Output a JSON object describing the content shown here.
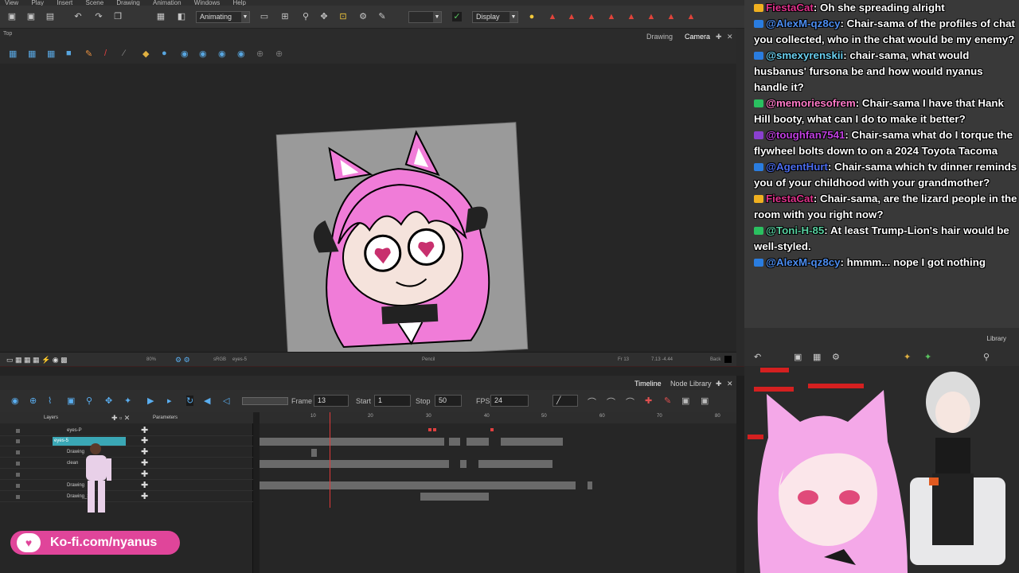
{
  "menu": [
    "View",
    "Play",
    "Insert",
    "Scene",
    "Drawing",
    "Animation",
    "Windows",
    "Help"
  ],
  "toolbar": {
    "mode_select": "Animating",
    "display_select": "Display"
  },
  "camera_view": {
    "title": "Top",
    "tabs": [
      "Drawing",
      "Camera"
    ]
  },
  "status_bar": {
    "zoom": "80%",
    "color_space": "sRGB",
    "layer": "eyes-5",
    "tool": "Pencil",
    "frame": "Fr 13",
    "coords": "7.13 -4.44",
    "bg": "Back"
  },
  "timeline": {
    "tabs": [
      "Timeline",
      "Node Library"
    ],
    "frame_label": "Frame",
    "frame_value": "13",
    "start_label": "Start",
    "start_value": "1",
    "stop_label": "Stop",
    "stop_value": "50",
    "fps_label": "FPS",
    "fps_value": "24",
    "layers_header": "Layers",
    "params_header": "Parameters",
    "ruler_ticks": [
      "10",
      "20",
      "30",
      "40",
      "50",
      "60",
      "70",
      "80"
    ],
    "layers": [
      {
        "name": "eyes-P",
        "selected": false
      },
      {
        "name": "eyes-5",
        "selected": true
      },
      {
        "name": "Drawing",
        "selected": false
      },
      {
        "name": "clean",
        "selected": false
      },
      {
        "name": "",
        "selected": false
      },
      {
        "name": "Drawing",
        "selected": false
      },
      {
        "name": "Drawing_3",
        "selected": false
      }
    ]
  },
  "kofi": {
    "text": "Ko-fi.com/nyanus"
  },
  "chat": [
    {
      "user": "FiestaCat",
      "user_color": "#e0338c",
      "message": "Oh she spreading alright"
    },
    {
      "user": "@AlexM-qz8cy",
      "user_color": "#4c8df0",
      "message": "Chair-sama of the profiles of chat you collected, who in the chat would be my enemy?"
    },
    {
      "user": "@smexyrenskii",
      "user_color": "#6ad0f0",
      "message": "chair-sama, what would husbanus' fursona be and how would nyanus handle it?"
    },
    {
      "user": "@memoriesofrem",
      "user_color": "#ff7ac8",
      "message": "Chair-sama I have that Hank Hill booty, what can I do to make it better?"
    },
    {
      "user": "@toughfan7541",
      "user_color": "#c040e0",
      "message": "Chair-sama what do I torque the flywheel bolts down to on a 2024 Toyota Tacoma"
    },
    {
      "user": "@AgentHurt",
      "user_color": "#4c6df0",
      "message": "Chair-sama which tv dinner reminds you of your childhood with your grandmother?"
    },
    {
      "user": "FiestaCat",
      "user_color": "#e0338c",
      "message": "Chair-sama, are the lizard people in the room with you right now?"
    },
    {
      "user": "@Toni-H-85",
      "user_color": "#58d0a0",
      "message": "At least Trump-Lion's hair would be well-styled."
    },
    {
      "user": "@AlexM-qz8cy",
      "user_color": "#4c8df0",
      "message": "hmmm... nope I got nothing"
    }
  ],
  "library": {
    "tab": "Library"
  }
}
